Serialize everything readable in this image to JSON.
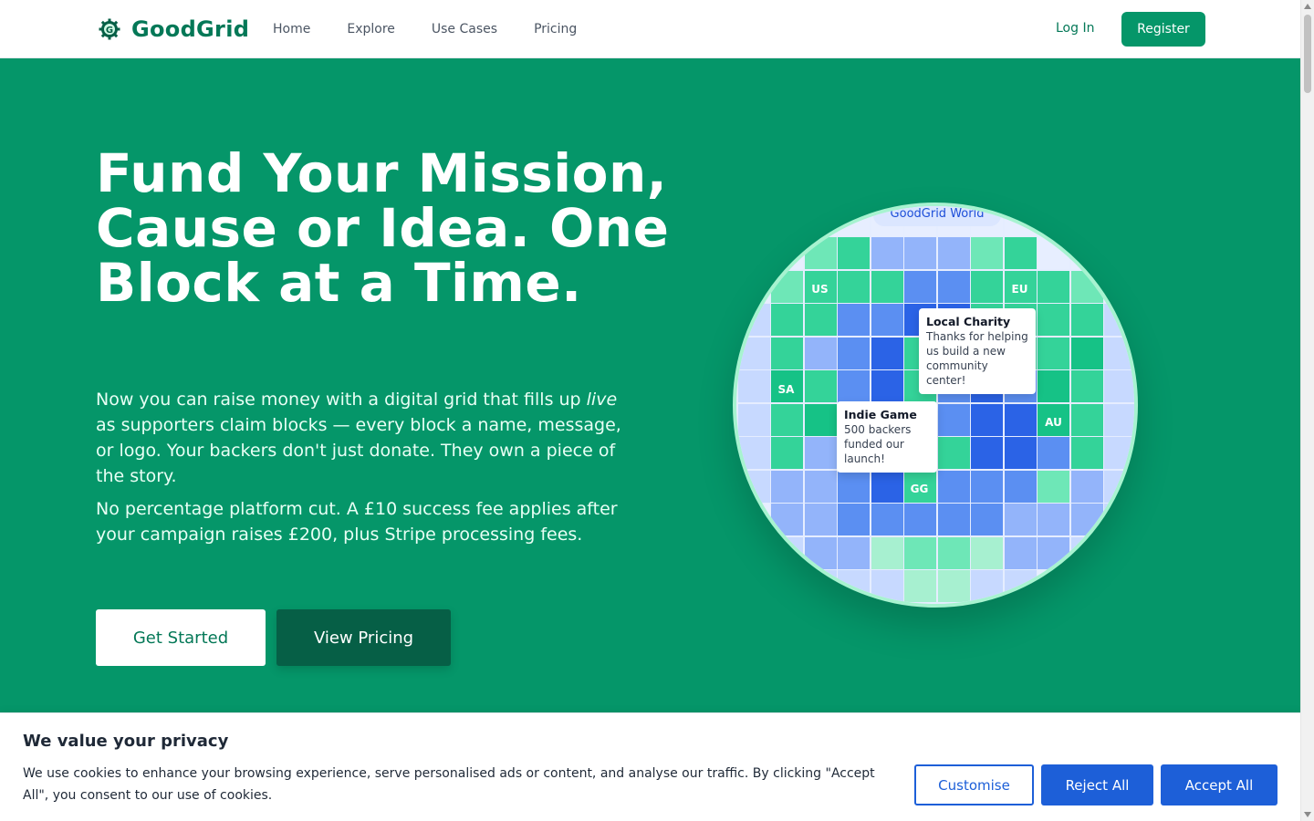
{
  "nav": {
    "logo_text": "GoodGrid",
    "links": [
      "Home",
      "Explore",
      "Use Cases",
      "Pricing"
    ],
    "login_label": "Log In",
    "register_label": "Register"
  },
  "hero": {
    "headline": "Fund Your Mission, Cause or Idea. One Block at a Time.",
    "para1_before": "Now you can raise money with a digital grid that fills up ",
    "para1_em": "live",
    "para1_after": " as supporters claim blocks — every block a name, message, or logo. Your backers don't just donate. They own a piece of the story.",
    "para2": "No percentage platform cut. A £10 success fee applies after your campaign raises £200, plus Stripe processing fees.",
    "get_started_label": "Get Started",
    "view_pricing_label": "View Pricing"
  },
  "grid": {
    "world_chip": "GoodGrid World",
    "region_labels": [
      "US",
      "EU",
      "SA",
      "AU",
      "GG"
    ],
    "tooltips": [
      {
        "title": "Local Charity",
        "body": "Thanks for helping us build a new community center!"
      },
      {
        "title": "Indie Game",
        "body": "500 backers funded our launch!"
      }
    ]
  },
  "cookie": {
    "title": "We value your privacy",
    "text": "We use cookies to enhance your browsing experience, serve personalised ads or content, and analyse our traffic. By clicking \"Accept All\", you consent to our use of cookies.",
    "customise_label": "Customise",
    "reject_label": "Reject All",
    "accept_label": "Accept All"
  },
  "colors": {
    "brand_green": "#059669",
    "dark_green": "#065f46",
    "cookie_blue": "#1d5fd8"
  }
}
